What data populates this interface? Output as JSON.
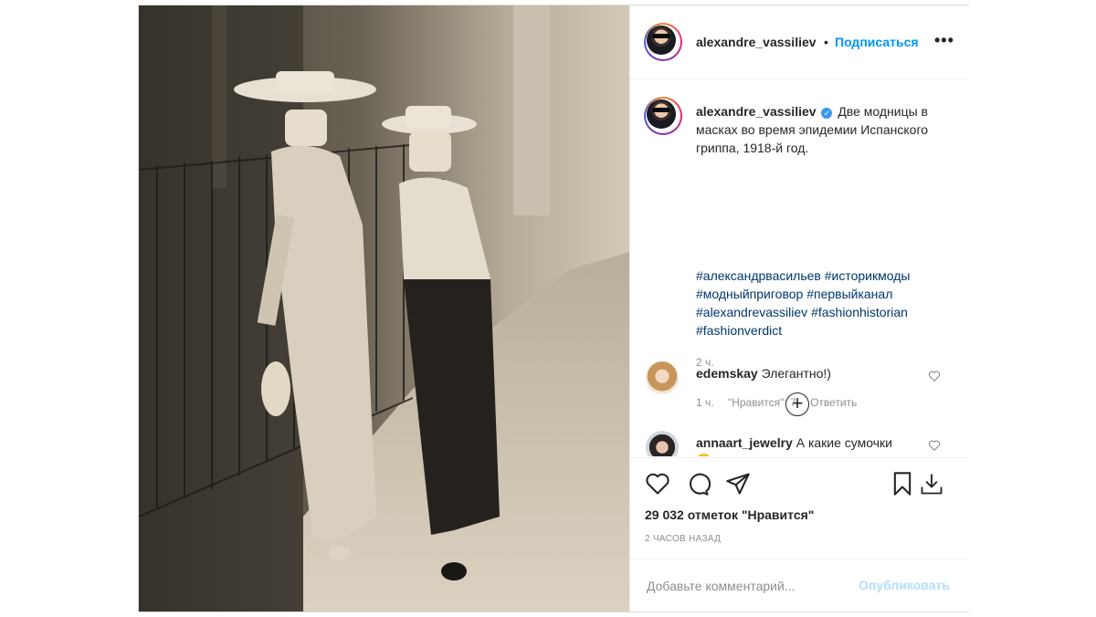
{
  "post": {
    "username": "alexandre_vassiliev",
    "header_separator": "•",
    "follow_label": "Подписаться",
    "more_icon": "more-dots-icon",
    "caption": {
      "username": "alexandre_vassiliev",
      "text": "Две модницы в масках во время эпидемии Испанского гриппа, 1918-й год.",
      "hashtags": [
        "#александрвасильев",
        "#историкмоды",
        "#модныйприговор",
        "#первыйканал",
        "#alexandrevassiliev",
        "#fashionhistorian",
        "#fashionverdict"
      ],
      "time": "2 ч."
    },
    "comments": [
      {
        "username": "edemskay",
        "text": "Элегантно!)",
        "time": "1 ч.",
        "likes": "\"Нравится\": 7",
        "reply": "Ответить"
      },
      {
        "username": "annaart_jewelry",
        "text": "А какие сумочки",
        "emoji": "😍"
      }
    ],
    "likes_text": "29 032 отметок \"Нравится\"",
    "posted_ago": "2 ЧАСОВ НАЗАД",
    "comment_placeholder": "Добавьте комментарий...",
    "publish_label": "Опубликовать",
    "colors": {
      "link": "#0095f6",
      "hashtag": "#00376b",
      "muted": "#8e8e8e",
      "publish_disabled": "#b2dffc"
    }
  }
}
